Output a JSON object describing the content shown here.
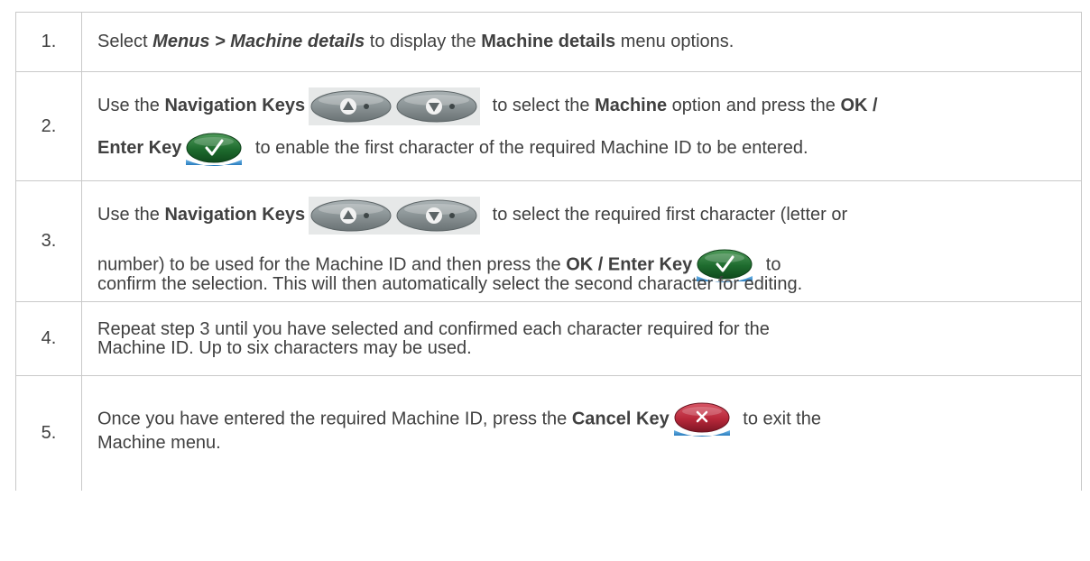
{
  "steps": [
    {
      "number": "1.",
      "parts": {
        "a": "Select ",
        "b": "Menus > Machine details",
        "c": " to display the ",
        "d": "Machine details",
        "e": " menu options."
      }
    },
    {
      "number": "2.",
      "parts": {
        "a": "Use the ",
        "b": "Navigation Keys",
        "c": " to select the ",
        "d": "Machine",
        "e": " option and press the ",
        "f": "OK /",
        "g": "Enter Key",
        "h": " to enable the first character of the required Machine ID to be entered."
      }
    },
    {
      "number": "3.",
      "parts": {
        "a": "Use the ",
        "b": "Navigation Keys",
        "c": " to select the required first character (letter or",
        "d": "number) to be used for the Machine ID and then press the ",
        "e": "OK / Enter Key",
        "f": " to",
        "g": "confirm the selection. This will then automatically select the second character for editing."
      }
    },
    {
      "number": "4.",
      "parts": {
        "a": "Repeat step 3 until you have selected and confirmed each character required for the",
        "b": "Machine ID. Up to six characters may be used."
      }
    },
    {
      "number": "5.",
      "parts": {
        "a": "Once you have entered the required Machine ID, press the ",
        "b": "Cancel Key",
        "c": " to exit the",
        "d": "Machine menu."
      }
    }
  ],
  "icons": {
    "up": "up-arrow-key-icon",
    "down": "down-arrow-key-icon",
    "ok": "ok-enter-key-icon",
    "cancel": "cancel-key-icon"
  },
  "colors": {
    "text": "#404040",
    "border": "#c9c9c9",
    "ok_key": "#1e6b2e",
    "cancel_key": "#b8283a",
    "nav_key": "#8a9395"
  }
}
